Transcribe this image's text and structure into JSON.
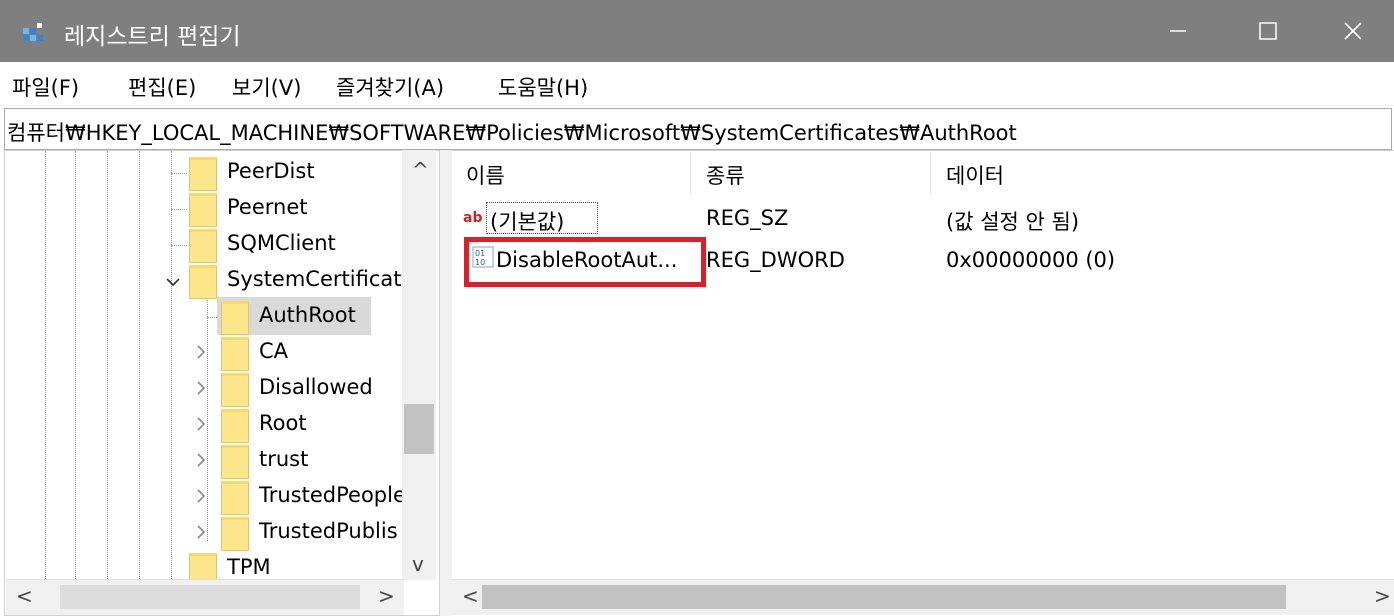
{
  "window": {
    "title": "레지스트리 편집기",
    "minimize_glyph": "—",
    "maximize_glyph": "☐",
    "close_glyph": "✕"
  },
  "menu": {
    "items": [
      {
        "label": "파일(F)"
      },
      {
        "label": "편집(E)"
      },
      {
        "label": "보기(V)"
      },
      {
        "label": "즐겨찾기(A)"
      },
      {
        "label": "도움말(H)"
      }
    ]
  },
  "address": {
    "path": "컴퓨터₩HKEY_LOCAL_MACHINE₩SOFTWARE₩Policies₩Microsoft₩SystemCertificates₩AuthRoot"
  },
  "tree": {
    "items": [
      {
        "label": "PeerDist",
        "expander": ""
      },
      {
        "label": "Peernet",
        "expander": ""
      },
      {
        "label": "SQMClient",
        "expander": ""
      },
      {
        "label": "SystemCertificat",
        "expander": "﹀"
      },
      {
        "label": "AuthRoot",
        "expander": "",
        "selected": true
      },
      {
        "label": "CA",
        "expander": "›"
      },
      {
        "label": "Disallowed",
        "expander": "›"
      },
      {
        "label": "Root",
        "expander": "›"
      },
      {
        "label": "trust",
        "expander": "›"
      },
      {
        "label": "TrustedPeople",
        "expander": "›"
      },
      {
        "label": "TrustedPublis",
        "expander": "›"
      },
      {
        "label": "TPM",
        "expander": ""
      }
    ],
    "scroll_up": "^",
    "scroll_down": "v",
    "scroll_left": "<",
    "scroll_right": ">"
  },
  "list": {
    "columns": {
      "name": "이름",
      "type": "종류",
      "data": "데이터"
    },
    "rows": [
      {
        "icon": "string-value-icon",
        "name": "(기본값)",
        "type": "REG_SZ",
        "data": "(값 설정 안 됨)"
      },
      {
        "icon": "dword-value-icon",
        "name": "DisableRootAut...",
        "type": "REG_DWORD",
        "data": "0x00000000 (0)"
      }
    ],
    "scroll_left": "<",
    "scroll_right": ">"
  },
  "colors": {
    "titlebar": "#7f7f7f",
    "highlight": "#e11d2a",
    "folder": "#fde68a",
    "selection": "#d9d9d9"
  }
}
